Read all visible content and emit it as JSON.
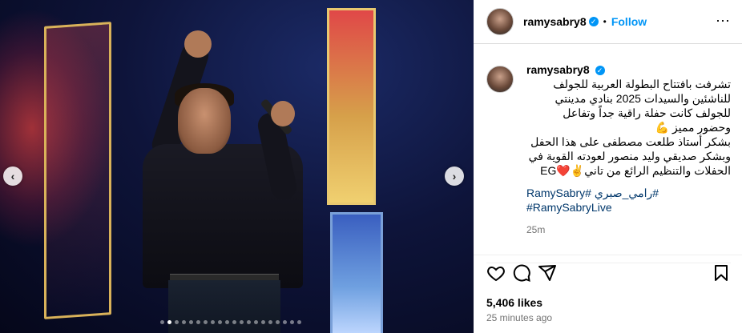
{
  "post": {
    "username": "ramysabry8",
    "follow_label": "Follow",
    "separator": "•",
    "more_icon": "⋯",
    "caption_user": "ramysabry8",
    "caption": "تشرفت بافتتاح البطولة العربية للجولف للناشئين والسيدات 2025 بنادي مدينتي للجولف كانت حفلة راقية جداً وتفاعل وحضور مميز 💪\nبشكر أستاذ طلعت مصطفى على هذا الحفل وبشكر صديقي وليد منصور لعودته القوية في الحفلات والتنظيم الرائع من تاني✌️❤️EG",
    "hashtags": "#رامي_صبري #RamySabry\n#RamySabryLive",
    "caption_time": "25m",
    "likes": "5,406 likes",
    "posted_ago": "25 minutes ago"
  },
  "carousel": {
    "prev_icon": "‹",
    "next_icon": "›",
    "total_slides": 20,
    "active_index": 1
  },
  "colors": {
    "accent": "#0095f6",
    "hashtag": "#00376b",
    "muted": "#737373"
  }
}
